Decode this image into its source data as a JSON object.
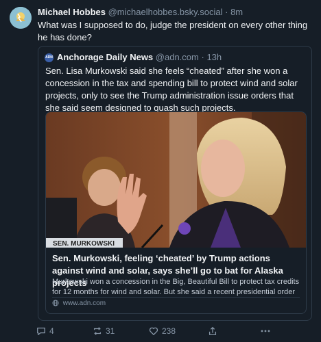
{
  "post": {
    "author_name": "Michael Hobbes",
    "author_handle": "@michaelhobbes.bsky.social",
    "separator": "·",
    "time": "8m",
    "text": "What was I supposed to do, judge the president on every other thing he has done?"
  },
  "quote": {
    "author_name": "Anchorage Daily News",
    "author_handle": "@adn.com",
    "separator": "·",
    "time": "13h",
    "avatar_text": "ADN",
    "text": "Sen. Lisa Murkowski said she feels “cheated” after she won a concession in the tax and spending bill to protect wind and solar projects, only to see the Trump administration issue orders that she said seem designed to quash such projects.",
    "card": {
      "nameplate": "SEN. MURKOWSKI",
      "title": "Sen. Murkowski, feeling ‘cheated’ by Trump actions against wind and solar, says she’ll go to bat for Alaska projects",
      "description": "Murkowski won a concession in the Big, Beautiful Bill to protect tax credits for 12 months for wind and solar. But she said a recent presidential order to",
      "domain": "www.adn.com"
    }
  },
  "actions": {
    "replies": "4",
    "reposts": "31",
    "likes": "238"
  },
  "icons": {
    "reply": "reply-icon",
    "repost": "repost-icon",
    "like": "like-icon",
    "share": "share-icon",
    "more": "more-icon",
    "globe": "globe-icon"
  },
  "colors": {
    "background": "#161e27",
    "text": "#f1f3f5",
    "muted": "#8796a7",
    "border": "#2e3b49"
  }
}
